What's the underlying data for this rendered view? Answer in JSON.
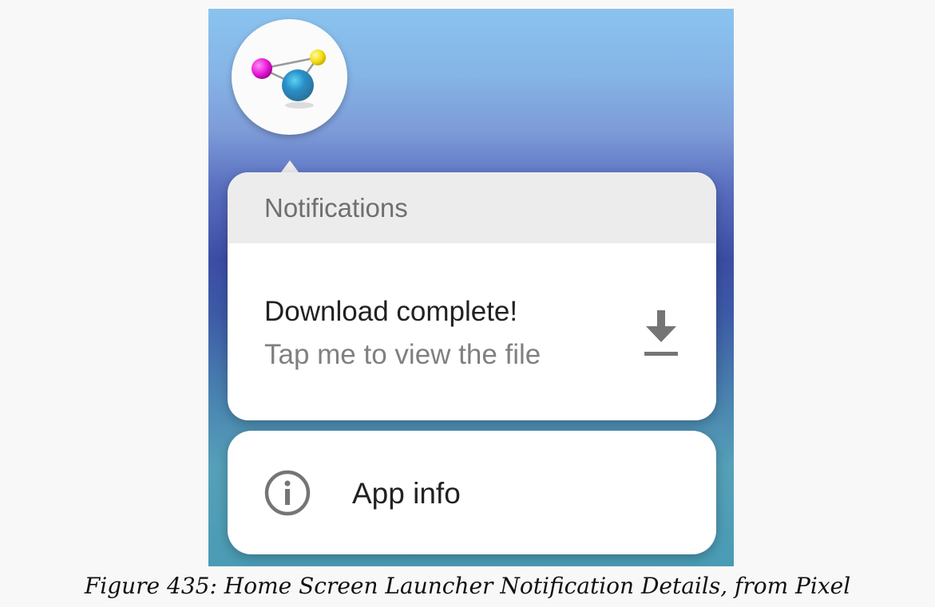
{
  "popup": {
    "header": "Notifications",
    "notification": {
      "title": "Download complete!",
      "text": "Tap me to view the file",
      "icon": "download-icon"
    },
    "shortcuts": [
      {
        "label": "App info",
        "icon": "info-icon"
      }
    ]
  },
  "app_icon": {
    "icon": "molecule-app-icon",
    "colors": {
      "magenta": "#e91ad8",
      "yellow": "#f5de12",
      "cyan": "#2a8fc7"
    }
  },
  "caption": "Figure 435: Home Screen Launcher Notification Details, from Pixel",
  "colors": {
    "wallpaper_top": "#8ac3ef",
    "wallpaper_mid": "#3b4da4",
    "wallpaper_bottom": "#4a9bb5",
    "card_background": "#ffffff",
    "header_background": "#ececec",
    "icon_gray": "#757575"
  }
}
